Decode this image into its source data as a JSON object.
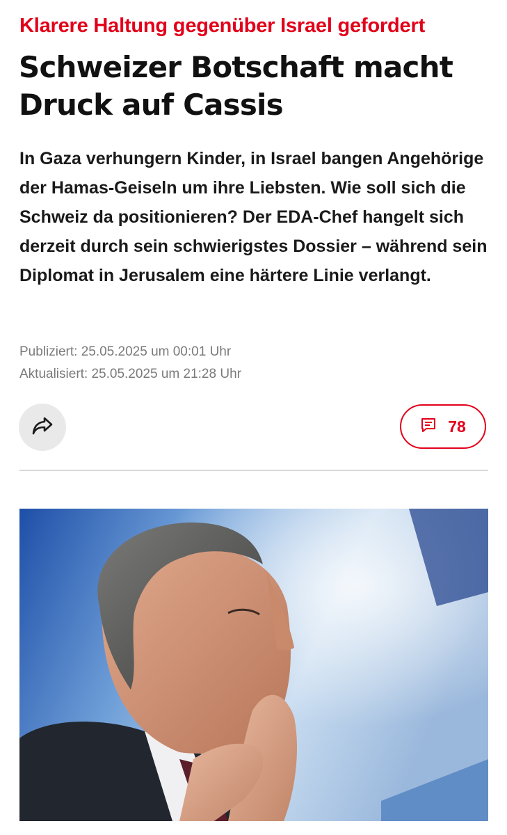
{
  "article": {
    "kicker": "Klarere Haltung gegenüber Israel gefordert",
    "headline": "Schweizer Botschaft macht Druck auf Cassis",
    "lead": "In Gaza verhungern Kinder, in Israel bangen Angehörige der Hamas-Geiseln um ihre Liebsten. Wie soll sich die Schweiz da positionieren? Der EDA-Chef hangelt sich derzeit durch sein schwierigstes Dossier – während sein Diplomat in Jerusalem eine härtere Linie verlangt.",
    "published": "Publiziert: 25.05.2025 um 00:01 Uhr",
    "updated": "Aktualisiert: 25.05.2025 um 21:28 Uhr"
  },
  "actions": {
    "share_icon": "share-arrow-icon",
    "comments_icon": "comment-bubble-icon",
    "comments_count": "78"
  },
  "colors": {
    "accent": "#e2001a",
    "text": "#111111",
    "meta": "#7a7a7a",
    "share_bg": "#e9e9e9"
  }
}
